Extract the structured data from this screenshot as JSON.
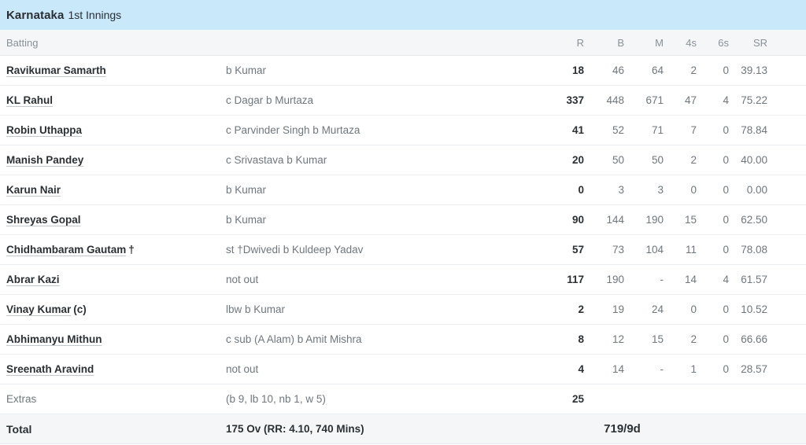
{
  "innings": {
    "team": "Karnataka",
    "label": "1st Innings"
  },
  "columns": {
    "batting": "Batting",
    "r": "R",
    "b": "B",
    "m": "M",
    "fours": "4s",
    "sixes": "6s",
    "sr": "SR"
  },
  "batsmen": [
    {
      "name": "Ravikumar Samarth",
      "suffix": "",
      "dismissal": "b Kumar",
      "r": "18",
      "b": "46",
      "m": "64",
      "fours": "2",
      "sixes": "0",
      "sr": "39.13"
    },
    {
      "name": "KL Rahul",
      "suffix": "",
      "dismissal": "c Dagar b Murtaza",
      "r": "337",
      "b": "448",
      "m": "671",
      "fours": "47",
      "sixes": "4",
      "sr": "75.22"
    },
    {
      "name": "Robin Uthappa",
      "suffix": "",
      "dismissal": "c Parvinder Singh b Murtaza",
      "r": "41",
      "b": "52",
      "m": "71",
      "fours": "7",
      "sixes": "0",
      "sr": "78.84"
    },
    {
      "name": "Manish Pandey",
      "suffix": "",
      "dismissal": "c Srivastava b Kumar",
      "r": "20",
      "b": "50",
      "m": "50",
      "fours": "2",
      "sixes": "0",
      "sr": "40.00"
    },
    {
      "name": "Karun Nair",
      "suffix": "",
      "dismissal": "b Kumar",
      "r": "0",
      "b": "3",
      "m": "3",
      "fours": "0",
      "sixes": "0",
      "sr": "0.00"
    },
    {
      "name": "Shreyas Gopal",
      "suffix": "",
      "dismissal": "b Kumar",
      "r": "90",
      "b": "144",
      "m": "190",
      "fours": "15",
      "sixes": "0",
      "sr": "62.50"
    },
    {
      "name": "Chidhambaram Gautam",
      "suffix": "†",
      "dismissal": "st †Dwivedi b Kuldeep Yadav",
      "r": "57",
      "b": "73",
      "m": "104",
      "fours": "11",
      "sixes": "0",
      "sr": "78.08"
    },
    {
      "name": "Abrar Kazi",
      "suffix": "",
      "dismissal": "not out",
      "r": "117",
      "b": "190",
      "m": "-",
      "fours": "14",
      "sixes": "4",
      "sr": "61.57"
    },
    {
      "name": "Vinay Kumar",
      "suffix": "(c)",
      "dismissal": "lbw b Kumar",
      "r": "2",
      "b": "19",
      "m": "24",
      "fours": "0",
      "sixes": "0",
      "sr": "10.52"
    },
    {
      "name": "Abhimanyu Mithun",
      "suffix": "",
      "dismissal": "c sub (A Alam) b Amit Mishra",
      "r": "8",
      "b": "12",
      "m": "15",
      "fours": "2",
      "sixes": "0",
      "sr": "66.66"
    },
    {
      "name": "Sreenath Aravind",
      "suffix": "",
      "dismissal": "not out",
      "r": "4",
      "b": "14",
      "m": "-",
      "fours": "1",
      "sixes": "0",
      "sr": "28.57"
    }
  ],
  "extras": {
    "label": "Extras",
    "breakdown": "(b 9, lb 10, nb 1, w 5)",
    "value": "25"
  },
  "total": {
    "label": "Total",
    "overs": "175 Ov (RR: 4.10, 740 Mins)",
    "score": "719/9d"
  }
}
